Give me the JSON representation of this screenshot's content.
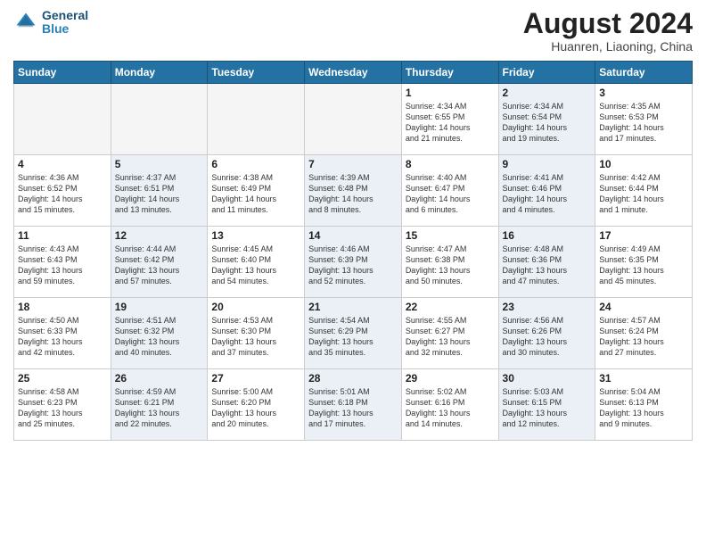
{
  "logo": {
    "line1": "General",
    "line2": "Blue"
  },
  "title": "August 2024",
  "location": "Huanren, Liaoning, China",
  "days_of_week": [
    "Sunday",
    "Monday",
    "Tuesday",
    "Wednesday",
    "Thursday",
    "Friday",
    "Saturday"
  ],
  "weeks": [
    [
      {
        "day": "",
        "text": "",
        "shaded": false,
        "empty": true
      },
      {
        "day": "",
        "text": "",
        "shaded": false,
        "empty": true
      },
      {
        "day": "",
        "text": "",
        "shaded": false,
        "empty": true
      },
      {
        "day": "",
        "text": "",
        "shaded": false,
        "empty": true
      },
      {
        "day": "1",
        "text": "Sunrise: 4:34 AM\nSunset: 6:55 PM\nDaylight: 14 hours\nand 21 minutes.",
        "shaded": false,
        "empty": false
      },
      {
        "day": "2",
        "text": "Sunrise: 4:34 AM\nSunset: 6:54 PM\nDaylight: 14 hours\nand 19 minutes.",
        "shaded": true,
        "empty": false
      },
      {
        "day": "3",
        "text": "Sunrise: 4:35 AM\nSunset: 6:53 PM\nDaylight: 14 hours\nand 17 minutes.",
        "shaded": false,
        "empty": false
      }
    ],
    [
      {
        "day": "4",
        "text": "Sunrise: 4:36 AM\nSunset: 6:52 PM\nDaylight: 14 hours\nand 15 minutes.",
        "shaded": false,
        "empty": false
      },
      {
        "day": "5",
        "text": "Sunrise: 4:37 AM\nSunset: 6:51 PM\nDaylight: 14 hours\nand 13 minutes.",
        "shaded": true,
        "empty": false
      },
      {
        "day": "6",
        "text": "Sunrise: 4:38 AM\nSunset: 6:49 PM\nDaylight: 14 hours\nand 11 minutes.",
        "shaded": false,
        "empty": false
      },
      {
        "day": "7",
        "text": "Sunrise: 4:39 AM\nSunset: 6:48 PM\nDaylight: 14 hours\nand 8 minutes.",
        "shaded": true,
        "empty": false
      },
      {
        "day": "8",
        "text": "Sunrise: 4:40 AM\nSunset: 6:47 PM\nDaylight: 14 hours\nand 6 minutes.",
        "shaded": false,
        "empty": false
      },
      {
        "day": "9",
        "text": "Sunrise: 4:41 AM\nSunset: 6:46 PM\nDaylight: 14 hours\nand 4 minutes.",
        "shaded": true,
        "empty": false
      },
      {
        "day": "10",
        "text": "Sunrise: 4:42 AM\nSunset: 6:44 PM\nDaylight: 14 hours\nand 1 minute.",
        "shaded": false,
        "empty": false
      }
    ],
    [
      {
        "day": "11",
        "text": "Sunrise: 4:43 AM\nSunset: 6:43 PM\nDaylight: 13 hours\nand 59 minutes.",
        "shaded": false,
        "empty": false
      },
      {
        "day": "12",
        "text": "Sunrise: 4:44 AM\nSunset: 6:42 PM\nDaylight: 13 hours\nand 57 minutes.",
        "shaded": true,
        "empty": false
      },
      {
        "day": "13",
        "text": "Sunrise: 4:45 AM\nSunset: 6:40 PM\nDaylight: 13 hours\nand 54 minutes.",
        "shaded": false,
        "empty": false
      },
      {
        "day": "14",
        "text": "Sunrise: 4:46 AM\nSunset: 6:39 PM\nDaylight: 13 hours\nand 52 minutes.",
        "shaded": true,
        "empty": false
      },
      {
        "day": "15",
        "text": "Sunrise: 4:47 AM\nSunset: 6:38 PM\nDaylight: 13 hours\nand 50 minutes.",
        "shaded": false,
        "empty": false
      },
      {
        "day": "16",
        "text": "Sunrise: 4:48 AM\nSunset: 6:36 PM\nDaylight: 13 hours\nand 47 minutes.",
        "shaded": true,
        "empty": false
      },
      {
        "day": "17",
        "text": "Sunrise: 4:49 AM\nSunset: 6:35 PM\nDaylight: 13 hours\nand 45 minutes.",
        "shaded": false,
        "empty": false
      }
    ],
    [
      {
        "day": "18",
        "text": "Sunrise: 4:50 AM\nSunset: 6:33 PM\nDaylight: 13 hours\nand 42 minutes.",
        "shaded": false,
        "empty": false
      },
      {
        "day": "19",
        "text": "Sunrise: 4:51 AM\nSunset: 6:32 PM\nDaylight: 13 hours\nand 40 minutes.",
        "shaded": true,
        "empty": false
      },
      {
        "day": "20",
        "text": "Sunrise: 4:53 AM\nSunset: 6:30 PM\nDaylight: 13 hours\nand 37 minutes.",
        "shaded": false,
        "empty": false
      },
      {
        "day": "21",
        "text": "Sunrise: 4:54 AM\nSunset: 6:29 PM\nDaylight: 13 hours\nand 35 minutes.",
        "shaded": true,
        "empty": false
      },
      {
        "day": "22",
        "text": "Sunrise: 4:55 AM\nSunset: 6:27 PM\nDaylight: 13 hours\nand 32 minutes.",
        "shaded": false,
        "empty": false
      },
      {
        "day": "23",
        "text": "Sunrise: 4:56 AM\nSunset: 6:26 PM\nDaylight: 13 hours\nand 30 minutes.",
        "shaded": true,
        "empty": false
      },
      {
        "day": "24",
        "text": "Sunrise: 4:57 AM\nSunset: 6:24 PM\nDaylight: 13 hours\nand 27 minutes.",
        "shaded": false,
        "empty": false
      }
    ],
    [
      {
        "day": "25",
        "text": "Sunrise: 4:58 AM\nSunset: 6:23 PM\nDaylight: 13 hours\nand 25 minutes.",
        "shaded": false,
        "empty": false
      },
      {
        "day": "26",
        "text": "Sunrise: 4:59 AM\nSunset: 6:21 PM\nDaylight: 13 hours\nand 22 minutes.",
        "shaded": true,
        "empty": false
      },
      {
        "day": "27",
        "text": "Sunrise: 5:00 AM\nSunset: 6:20 PM\nDaylight: 13 hours\nand 20 minutes.",
        "shaded": false,
        "empty": false
      },
      {
        "day": "28",
        "text": "Sunrise: 5:01 AM\nSunset: 6:18 PM\nDaylight: 13 hours\nand 17 minutes.",
        "shaded": true,
        "empty": false
      },
      {
        "day": "29",
        "text": "Sunrise: 5:02 AM\nSunset: 6:16 PM\nDaylight: 13 hours\nand 14 minutes.",
        "shaded": false,
        "empty": false
      },
      {
        "day": "30",
        "text": "Sunrise: 5:03 AM\nSunset: 6:15 PM\nDaylight: 13 hours\nand 12 minutes.",
        "shaded": true,
        "empty": false
      },
      {
        "day": "31",
        "text": "Sunrise: 5:04 AM\nSunset: 6:13 PM\nDaylight: 13 hours\nand 9 minutes.",
        "shaded": false,
        "empty": false
      }
    ]
  ]
}
